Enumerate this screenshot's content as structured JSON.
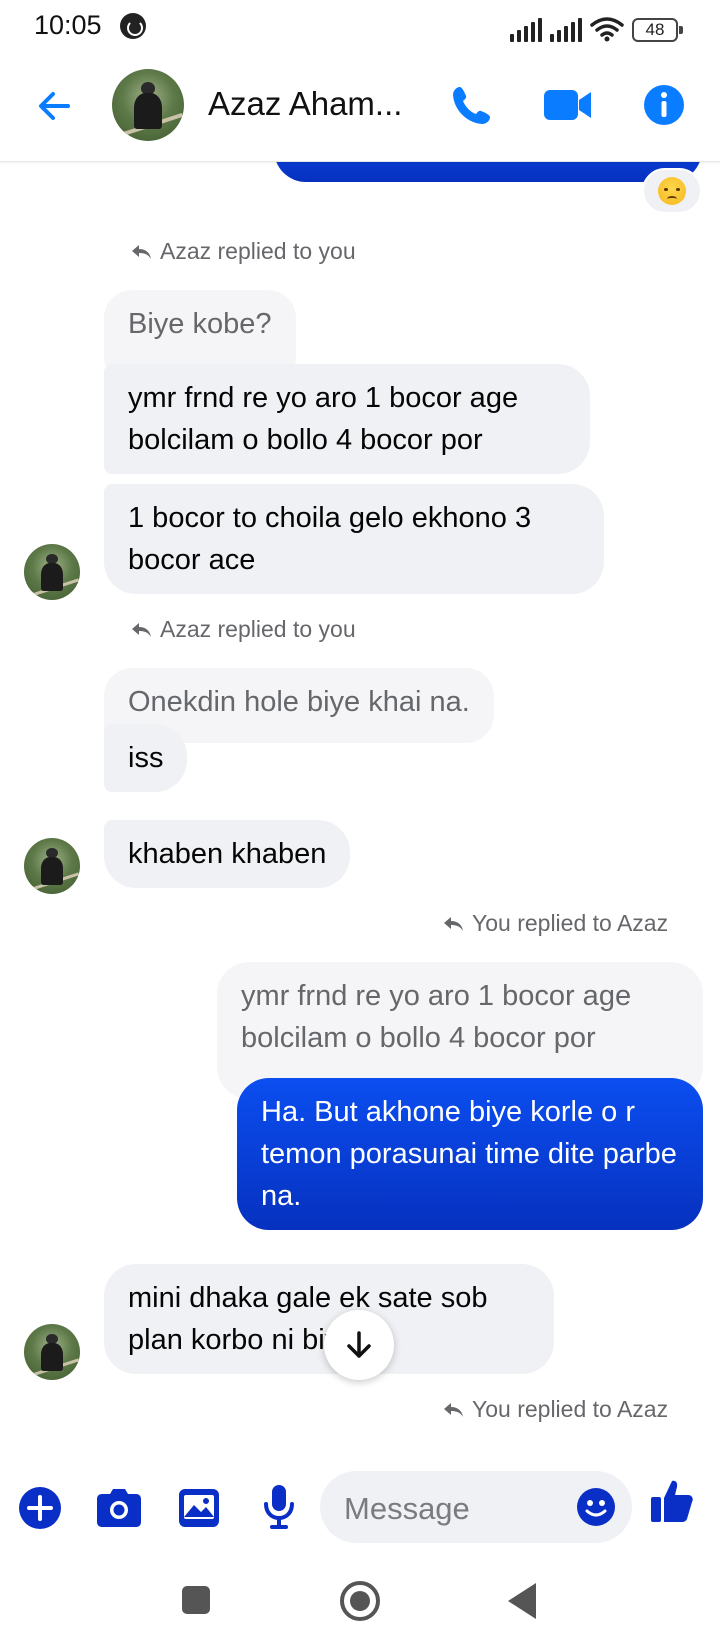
{
  "status_bar": {
    "time": "10:05",
    "battery": "48"
  },
  "header": {
    "contact_name": "Azaz Aham...",
    "icons": [
      "back-arrow-icon",
      "call-icon",
      "video-icon",
      "info-icon"
    ]
  },
  "colors": {
    "accent": "#0a7cff",
    "outgoing_bubble": "#0a3ad6",
    "incoming_bubble": "#f0f1f4"
  },
  "chat": {
    "reaction": "crying-emoji",
    "reply_labels": {
      "azaz_to_you_1": "Azaz replied to you",
      "azaz_to_you_2": "Azaz replied to you",
      "you_to_azaz_1": "You replied to Azaz",
      "you_to_azaz_2": "You replied to Azaz"
    },
    "messages": {
      "quote_1": "Biye kobe?",
      "in_1": "ymr frnd re yo aro 1 bocor age bolcilam o bollo 4 bocor por",
      "in_2": "1 bocor to choila gelo ekhono 3 bocor ace",
      "quote_2": "Onekdin hole biye khai na.",
      "in_3": "iss",
      "in_4": "khaben khaben",
      "quote_3": "ymr frnd re yo aro 1 bocor age bolcilam o bollo 4 bocor por",
      "out_1": "Ha. But akhone biye korle o r temon porasunai time dite parbe na.",
      "in_5": "mini dhaka gale ek sate sob plan korbo ni biywr"
    }
  },
  "composer": {
    "placeholder": "Message",
    "icons": [
      "plus-icon",
      "camera-icon",
      "gallery-icon",
      "microphone-icon",
      "emoji-icon",
      "thumbs-up-icon"
    ]
  },
  "navbar": {
    "icons": [
      "recents-icon",
      "home-icon",
      "back-icon"
    ]
  }
}
